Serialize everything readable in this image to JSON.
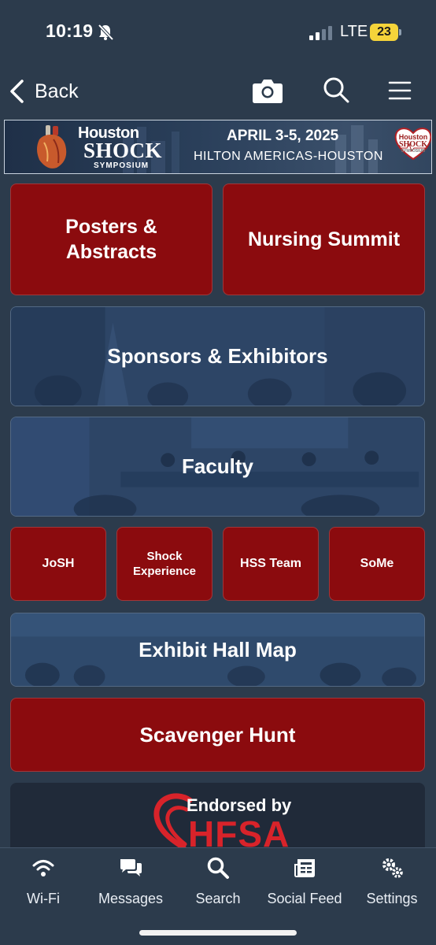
{
  "status_bar": {
    "time": "10:19",
    "network": "LTE",
    "battery": "23"
  },
  "nav": {
    "back_label": "Back"
  },
  "banner": {
    "title_houston": "Houston",
    "title_shock": "SHOCK",
    "title_symposium": "SYMPOSIUM",
    "dates": "APRIL 3-5, 2025",
    "venue": "HILTON AMERICAS-HOUSTON",
    "logo_houston": "Houston",
    "logo_shock": "SHOCK",
    "logo_symposium": "SYMPOSIUM"
  },
  "tiles": {
    "posters_line1": "Posters &",
    "posters_line2": "Abstracts",
    "nursing": "Nursing Summit",
    "sponsors": "Sponsors & Exhibitors",
    "faculty": "Faculty",
    "josh": "JoSH",
    "shock_exp_line1": "Shock",
    "shock_exp_line2": "Experience",
    "hss": "HSS Team",
    "some": "SoMe",
    "exhibit_map": "Exhibit Hall Map",
    "scavenger": "Scavenger Hunt"
  },
  "endorsement": {
    "line1": "Endorsed by",
    "line2": "HFSA"
  },
  "tab_bar": {
    "wifi": "Wi-Fi",
    "messages": "Messages",
    "search": "Search",
    "social_feed": "Social Feed",
    "settings": "Settings"
  },
  "colors": {
    "background": "#2c3b4c",
    "tile_red": "#8b0b0e",
    "tile_photo": "#2e4869",
    "battery": "#f5d43a",
    "hfsa_red": "#d8232a"
  }
}
